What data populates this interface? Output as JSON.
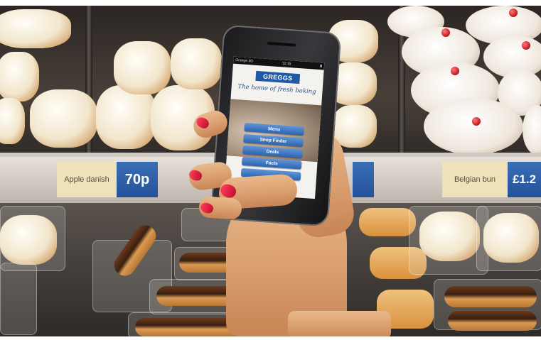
{
  "phone_app": {
    "status_left": "Orange 3G",
    "status_time": "12:15",
    "brand_logo": "GREGGS",
    "tagline": "The home of fresh baking",
    "menu_items": [
      "Menu",
      "Shop Finder",
      "Deals",
      "Facts",
      ""
    ]
  },
  "shelf_labels": {
    "left_tag": "Apple danish",
    "left_price": "70p",
    "right_tag": "Belgian bun",
    "right_price": "£1.2"
  }
}
